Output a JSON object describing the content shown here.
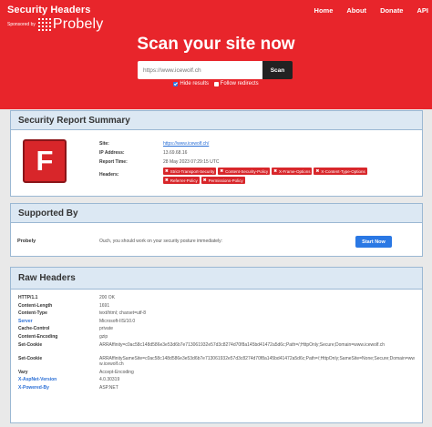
{
  "brand": {
    "title": "Security Headers",
    "sponsor": "Sponsored by",
    "logo_text": "Probely"
  },
  "nav": [
    "Home",
    "About",
    "Donate",
    "API"
  ],
  "scan": {
    "title": "Scan your site now",
    "input_placeholder": "https://www.icewolf.ch",
    "button": "Scan",
    "hide_results": "Hide results",
    "follow_redirects": "Follow redirects",
    "hide_results_checked": true,
    "follow_redirects_checked": false
  },
  "summary": {
    "heading": "Security Report Summary",
    "grade": "F",
    "grade_color": "#d8262a",
    "site_label": "Site:",
    "site": "https://www.icewolf.ch/",
    "ip_label": "IP Address:",
    "ip": "13.69.68.16",
    "time_label": "Report Time:",
    "time": "28 May 2023 07:29:15 UTC",
    "headers_label": "Headers:",
    "missing_headers": [
      "Strict-Transport-Security",
      "Content-Security-Policy",
      "X-Frame-Options",
      "X-Content-Type-Options",
      "Referrer-Policy",
      "Permissions-Policy"
    ]
  },
  "supported": {
    "heading": "Supported By",
    "name": "Probely",
    "message": "Ouch, you should work on your security posture immediately:",
    "button": "Start Now"
  },
  "raw": {
    "heading": "Raw Headers",
    "rows": [
      {
        "k": "HTTP/1.1",
        "v": "200 OK"
      },
      {
        "k": "Content-Length",
        "v": "1691"
      },
      {
        "k": "Content-Type",
        "v": "text/html; charset=utf-8"
      },
      {
        "k": "Server",
        "v": "Microsoft-IIS/10.0",
        "blue": true
      },
      {
        "k": "Cache-Control",
        "v": "private"
      },
      {
        "k": "Content-Encoding",
        "v": "gzip"
      },
      {
        "k": "Set-Cookie",
        "v": "ARRAffinity=c0ac58c148d586e3e53d6b7e713061932e57d3c8274d70f8a145bd41472a5d6c;Path=/;HttpOnly;Secure;Domain=www.icewolf.ch",
        "tall": true
      },
      {
        "k": "Set-Cookie",
        "v": "ARRAffinitySameSite=c0ac58c148d586e3e53d6b7e713061932e57d3c8274d70f8a145bd41472a5d6c;Path=/;HttpOnly;SameSite=None;Secure;Domain=www.icewolf.ch",
        "tall": true
      },
      {
        "k": "Vary",
        "v": "Accept-Encoding"
      },
      {
        "k": "X-AspNet-Version",
        "v": "4.0.30319",
        "blue": true
      },
      {
        "k": "X-Powered-By",
        "v": "ASP.NET",
        "blue": true
      }
    ]
  }
}
